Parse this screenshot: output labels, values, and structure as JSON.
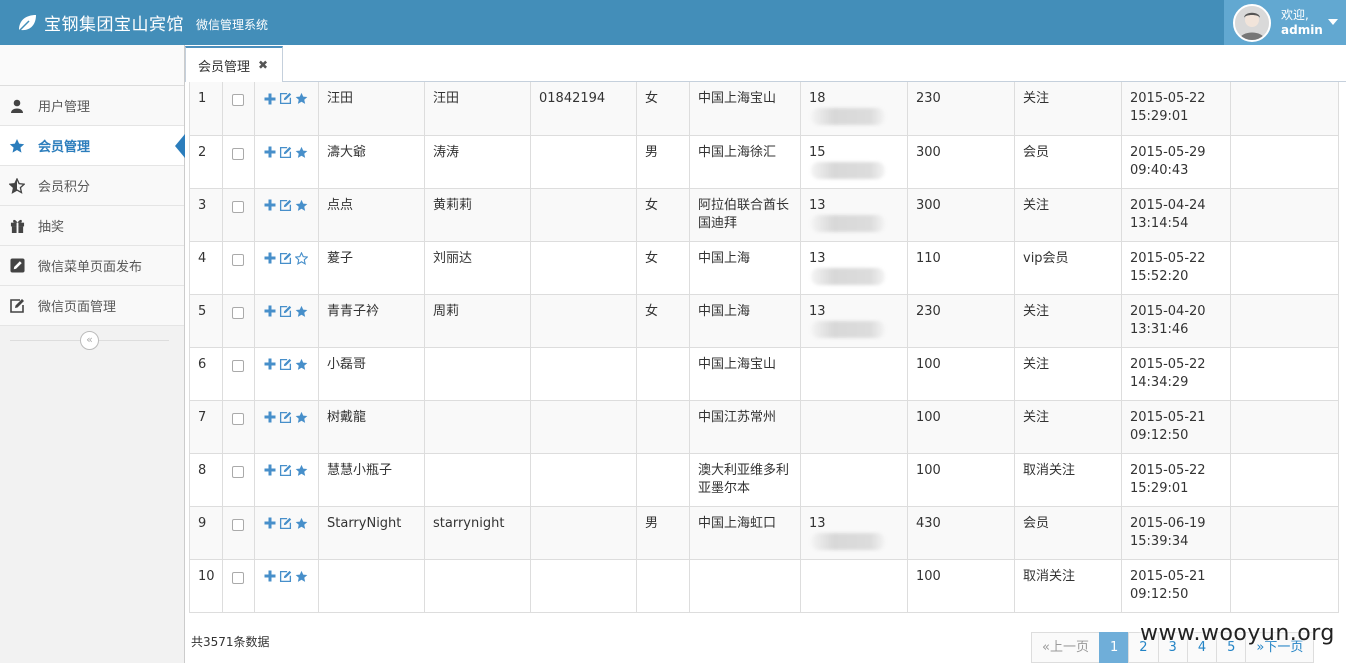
{
  "header": {
    "title": "宝钢集团宝山宾馆",
    "subtitle": "微信管理系统",
    "welcome": "欢迎,",
    "username": "admin"
  },
  "sidebar": {
    "items": [
      {
        "label": "用户管理",
        "icon": "user-icon"
      },
      {
        "label": "会员管理",
        "icon": "star-icon",
        "active": true
      },
      {
        "label": "会员积分",
        "icon": "star-half-icon"
      },
      {
        "label": "抽奖",
        "icon": "gift-icon"
      },
      {
        "label": "微信菜单页面发布",
        "icon": "edit-square-icon"
      },
      {
        "label": "微信页面管理",
        "icon": "edit-icon"
      }
    ],
    "collapse_glyph": "«"
  },
  "tabs": [
    {
      "label": "会员管理",
      "close": "✖"
    }
  ],
  "table": {
    "rows": [
      {
        "no": "1",
        "nick": "汪田",
        "name": "汪田",
        "card": "01842194",
        "sex": "女",
        "addr": "中国上海宝山",
        "phone": "18",
        "points": "230",
        "status": "关注",
        "date": "2015-05-22",
        "time": "15:29:01",
        "star": "filled"
      },
      {
        "no": "2",
        "nick": "濤大爺",
        "name": "涛涛",
        "card": "",
        "sex": "男",
        "addr": "中国上海徐汇",
        "phone": "15",
        "points": "300",
        "status": "会员",
        "date": "2015-05-29",
        "time": "09:40:43",
        "star": "filled"
      },
      {
        "no": "3",
        "nick": "点点",
        "name": "黄莉莉",
        "card": "",
        "sex": "女",
        "addr": "阿拉伯联合酋长国迪拜",
        "phone": "13",
        "points": "300",
        "status": "关注",
        "date": "2015-04-24",
        "time": "13:14:54",
        "star": "filled"
      },
      {
        "no": "4",
        "nick": "萲子",
        "name": "刘丽达",
        "card": "",
        "sex": "女",
        "addr": "中国上海",
        "phone": "13",
        "points": "110",
        "status": "vip会员",
        "date": "2015-05-22",
        "time": "15:52:20",
        "star": "empty"
      },
      {
        "no": "5",
        "nick": "青青子衿",
        "name": "周莉",
        "card": "",
        "sex": "女",
        "addr": "中国上海",
        "phone": "13",
        "points": "230",
        "status": "关注",
        "date": "2015-04-20",
        "time": "13:31:46",
        "star": "filled"
      },
      {
        "no": "6",
        "nick": "小磊哥",
        "name": "",
        "card": "",
        "sex": "",
        "addr": "中国上海宝山",
        "phone": "",
        "points": "100",
        "status": "关注",
        "date": "2015-05-22",
        "time": "14:34:29",
        "star": "filled"
      },
      {
        "no": "7",
        "nick": "树戴龍",
        "name": "",
        "card": "",
        "sex": "",
        "addr": "中国江苏常州",
        "phone": "",
        "points": "100",
        "status": "关注",
        "date": "2015-05-21",
        "time": "09:12:50",
        "star": "filled"
      },
      {
        "no": "8",
        "nick": "慧慧小瓶子",
        "name": "",
        "card": "",
        "sex": "",
        "addr": "澳大利亚维多利亚墨尔本",
        "phone": "",
        "points": "100",
        "status": "取消关注",
        "date": "2015-05-22",
        "time": "15:29:01",
        "star": "filled"
      },
      {
        "no": "9",
        "nick": "StarryNight",
        "name": "starrynight",
        "card": "",
        "sex": "男",
        "addr": "中国上海虹口",
        "phone": "13",
        "points": "430",
        "status": "会员",
        "date": "2015-06-19",
        "time": "15:39:34",
        "star": "filled"
      },
      {
        "no": "10",
        "nick": "",
        "name": "",
        "card": "",
        "sex": "",
        "addr": "",
        "phone": "",
        "points": "100",
        "status": "取消关注",
        "date": "2015-05-21",
        "time": "09:12:50",
        "star": "filled"
      }
    ]
  },
  "footer": {
    "total": "共3571条数据",
    "pager": [
      "«上一页",
      "1",
      "2",
      "3",
      "4",
      "5",
      "»下一页"
    ],
    "active_page": "1"
  },
  "watermark": "www.wooyun.org",
  "colors": {
    "header_bg": "#438eb9",
    "user_bg": "#62a8d1",
    "accent": "#2b7dbc",
    "icon_blue": "#478fca"
  }
}
